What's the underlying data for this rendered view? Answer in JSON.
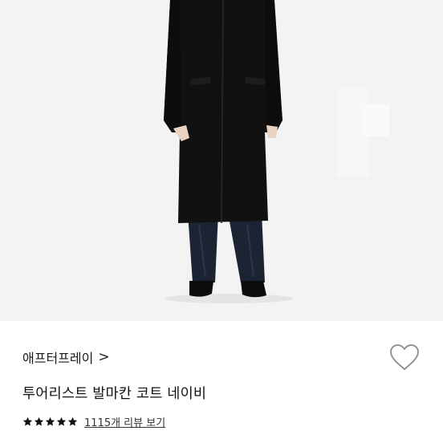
{
  "product": {
    "brand": "애프터프레이",
    "brand_chevron": ">",
    "title": "투어리스트 발마칸 코트 네이비",
    "rating_stars": 5,
    "review_link": "1115개 리뷰 보기",
    "wishlist_icon": "heart-outline-icon"
  },
  "colors": {
    "background": "#ffffff",
    "photo_bg": "#f2f2f2",
    "coat": "#111111",
    "pants": "#1c2333",
    "text": "#111111"
  }
}
